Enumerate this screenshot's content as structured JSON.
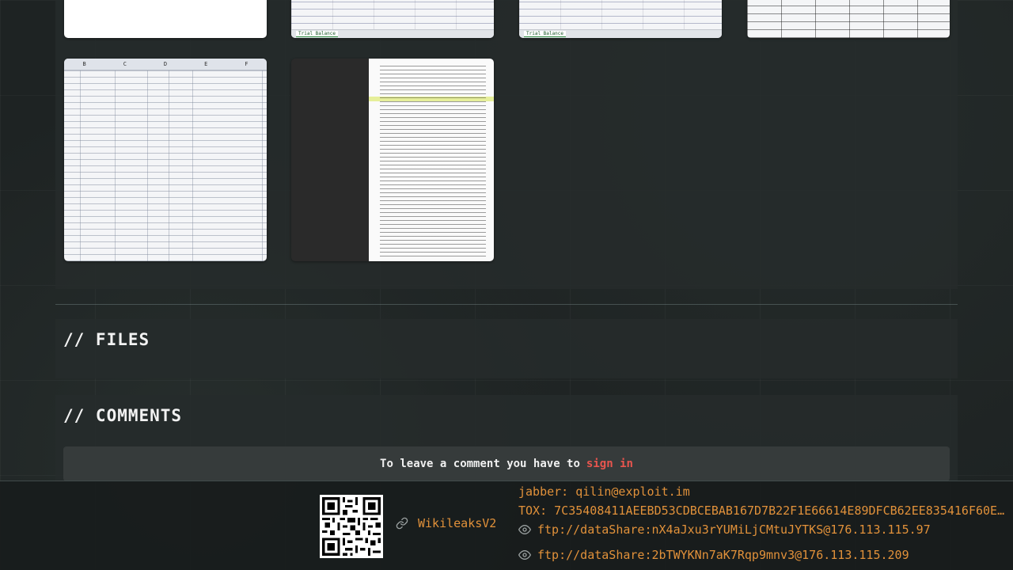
{
  "gallery": {
    "thumbs": [
      {
        "name": "thumb-1",
        "kind": "blank"
      },
      {
        "name": "thumb-2",
        "kind": "ledger",
        "tab": "Trial Balance"
      },
      {
        "name": "thumb-3",
        "kind": "ledger",
        "tab": "Trial Balance"
      },
      {
        "name": "thumb-4",
        "kind": "form"
      },
      {
        "name": "thumb-5",
        "kind": "sheet",
        "columns": [
          "B",
          "C",
          "D",
          "E",
          "F"
        ]
      },
      {
        "name": "thumb-6",
        "kind": "doc"
      }
    ]
  },
  "files": {
    "title": "// FILES"
  },
  "comments": {
    "title": "// COMMENTS",
    "prompt": "To leave a comment you have to",
    "signin": "sign in"
  },
  "footer": {
    "wiki_link": "WikileaksV2",
    "jabber": "jabber: qilin@exploit.im",
    "tox": "TOX: 7C35408411AEEBD53CDBCEBAB167D7B22F1E66614E89DFCB62EE835416F60E1BC…",
    "ftp1": "ftp://dataShare:nX4aJxu3rYUMiLjCMtuJYTKS@176.113.115.97",
    "ftp2": "ftp://dataShare:2bTWYKNn7aK7Rqp9mnv3@176.113.115.209"
  },
  "colors": {
    "accent": "#e1913a",
    "signin": "#e8554e",
    "background": "#1e2323",
    "panel": "#262b2b"
  }
}
